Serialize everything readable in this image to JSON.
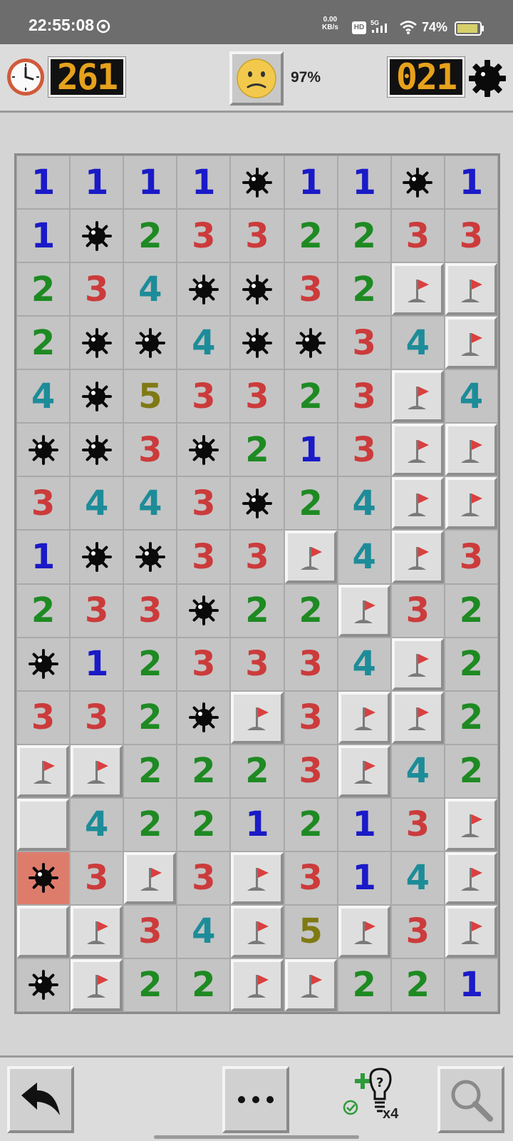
{
  "status_bar": {
    "time": "22:55:08",
    "net_speed_value": "0.00",
    "net_speed_unit": "KB/s",
    "hd_label": "HD",
    "network_label": "5G",
    "battery_percent": "74%"
  },
  "game": {
    "timer": "261",
    "progress_percent": "97%",
    "mines_remaining": "021",
    "face_state": "worried"
  },
  "board": {
    "columns": 9,
    "rows": 16,
    "legend": "digit = revealed number, * = mine, F = flag, . = unopened tile, X = exploded mine",
    "cells": [
      [
        "1",
        "1",
        "1",
        "1",
        "*",
        "1",
        "1",
        "*",
        "1"
      ],
      [
        "1",
        "*",
        "2",
        "3",
        "3",
        "2",
        "2",
        "3",
        "3"
      ],
      [
        "2",
        "3",
        "4",
        "*",
        "*",
        "3",
        "2",
        "F",
        "F"
      ],
      [
        "2",
        "*",
        "*",
        "4",
        "*",
        "*",
        "3",
        "4",
        "F"
      ],
      [
        "4",
        "*",
        "5",
        "3",
        "3",
        "2",
        "3",
        "F",
        "4"
      ],
      [
        "*",
        "*",
        "3",
        "*",
        "2",
        "1",
        "3",
        "F",
        "F"
      ],
      [
        "3",
        "4",
        "4",
        "3",
        "*",
        "2",
        "4",
        "F",
        "F"
      ],
      [
        "1",
        "*",
        "*",
        "3",
        "3",
        "F",
        "4",
        "F",
        "3"
      ],
      [
        "2",
        "3",
        "3",
        "*",
        "2",
        "2",
        "F",
        "3",
        "2"
      ],
      [
        "*",
        "1",
        "2",
        "3",
        "3",
        "3",
        "4",
        "F",
        "2"
      ],
      [
        "3",
        "3",
        "2",
        "*",
        "F",
        "3",
        "F",
        "F",
        "2"
      ],
      [
        "F",
        "F",
        "2",
        "2",
        "2",
        "3",
        "F",
        "4",
        "2"
      ],
      [
        ".",
        "4",
        "2",
        "2",
        "1",
        "2",
        "1",
        "3",
        "F"
      ],
      [
        "X",
        "3",
        "F",
        "3",
        "F",
        "3",
        "1",
        "4",
        "F"
      ],
      [
        ".",
        "F",
        "3",
        "4",
        "F",
        "5",
        "F",
        "3",
        "F"
      ],
      [
        "*",
        "F",
        "2",
        "2",
        "F",
        "F",
        "2",
        "2",
        "1"
      ]
    ]
  },
  "toolbar": {
    "hint_count": "x4"
  },
  "icons": {
    "clock": "clock-icon",
    "settings": "gear-icon",
    "undo": "undo-arrow-icon",
    "more": "more-dots-icon",
    "hint": "lightbulb-hint-icon",
    "search": "magnifier-icon"
  },
  "colors": {
    "lcd_digits": "#e6a21c",
    "number_1": "#1a1ac8",
    "number_2": "#1e8a22",
    "number_3": "#cc3b3b",
    "number_4": "#1d8c99",
    "number_5": "#7f7a14",
    "exploded_cell": "#de7c6c",
    "flag": "#d94040"
  }
}
